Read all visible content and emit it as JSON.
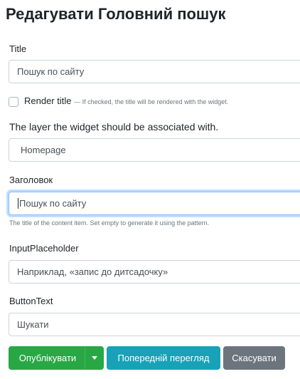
{
  "page": {
    "title": "Редагувати Головний пошук"
  },
  "title_field": {
    "label": "Title",
    "value": "Пошук по сайту"
  },
  "render_title": {
    "label": "Render title",
    "hint": "— If checked, the title will be rendered with the widget.",
    "checked": false
  },
  "layer_field": {
    "label": "The layer the widget should be associated with.",
    "value": "Homepage"
  },
  "heading_field": {
    "label": "Заголовок",
    "value": "Пошук по сайту",
    "hint": "The title of the content item. Set empty to generate it using the pattern."
  },
  "placeholder_field": {
    "label": "InputPlaceholder",
    "value": "Наприклад, «запис до дитсадочку»"
  },
  "button_text_field": {
    "label": "ButtonText",
    "value": "Шукати"
  },
  "actions": {
    "publish": "Опублікувати",
    "preview": "Попередній перегляд",
    "cancel": "Скасувати"
  },
  "colors": {
    "publish": "#28a745",
    "preview": "#17a2b8",
    "cancel": "#6c757d",
    "focus": "#80bdff"
  }
}
